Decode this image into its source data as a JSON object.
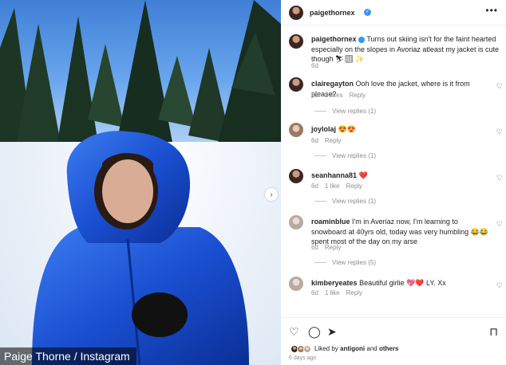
{
  "photo": {
    "credit": "Paige Thorne / Instagram",
    "next_arrow": "›"
  },
  "post": {
    "author": "paigethornex",
    "more_icon": "•••",
    "caption": "Turns out skiing isn't for the faint hearted especially on the slopes in Avoriaz atleast my jacket is cute though",
    "caption_emoji": "⛷🏻 ✨",
    "age": "6d"
  },
  "comments": [
    {
      "user": "clairegayton",
      "text": "Ooh love the jacket, where is it from please?",
      "age": "6d",
      "likes": "3 likes",
      "reply": "Reply",
      "view_replies": "View replies (1)"
    },
    {
      "user": "joylolaj",
      "text": "😍😍",
      "age": "6d",
      "likes": "",
      "reply": "Reply",
      "view_replies": "View replies (1)"
    },
    {
      "user": "seanhanna81",
      "text": "❤️",
      "age": "6d",
      "likes": "1 like",
      "reply": "Reply",
      "view_replies": "View replies (1)"
    },
    {
      "user": "roaminblue",
      "text": "I'm in Averiaz now, I'm learning to snowboard at 40yrs old, today was very humbling 😂😂 spent most of the day on my arse",
      "age": "6d",
      "likes": "",
      "reply": "Reply",
      "view_replies": "View replies (5)"
    },
    {
      "user": "kimberyeates",
      "text": "Beautiful girlie 💖❤️ LY. Xx",
      "age": "6d",
      "likes": "1 like",
      "reply": "Reply",
      "view_replies": ""
    }
  ],
  "actions": {
    "like_icon": "♡",
    "comment_icon": "◯",
    "share_icon": "➤",
    "save_icon": "⊓",
    "liked_prefix": "Liked by",
    "liked_user": "antigoni",
    "liked_and": "and",
    "liked_others": "others",
    "time": "6 days ago"
  }
}
